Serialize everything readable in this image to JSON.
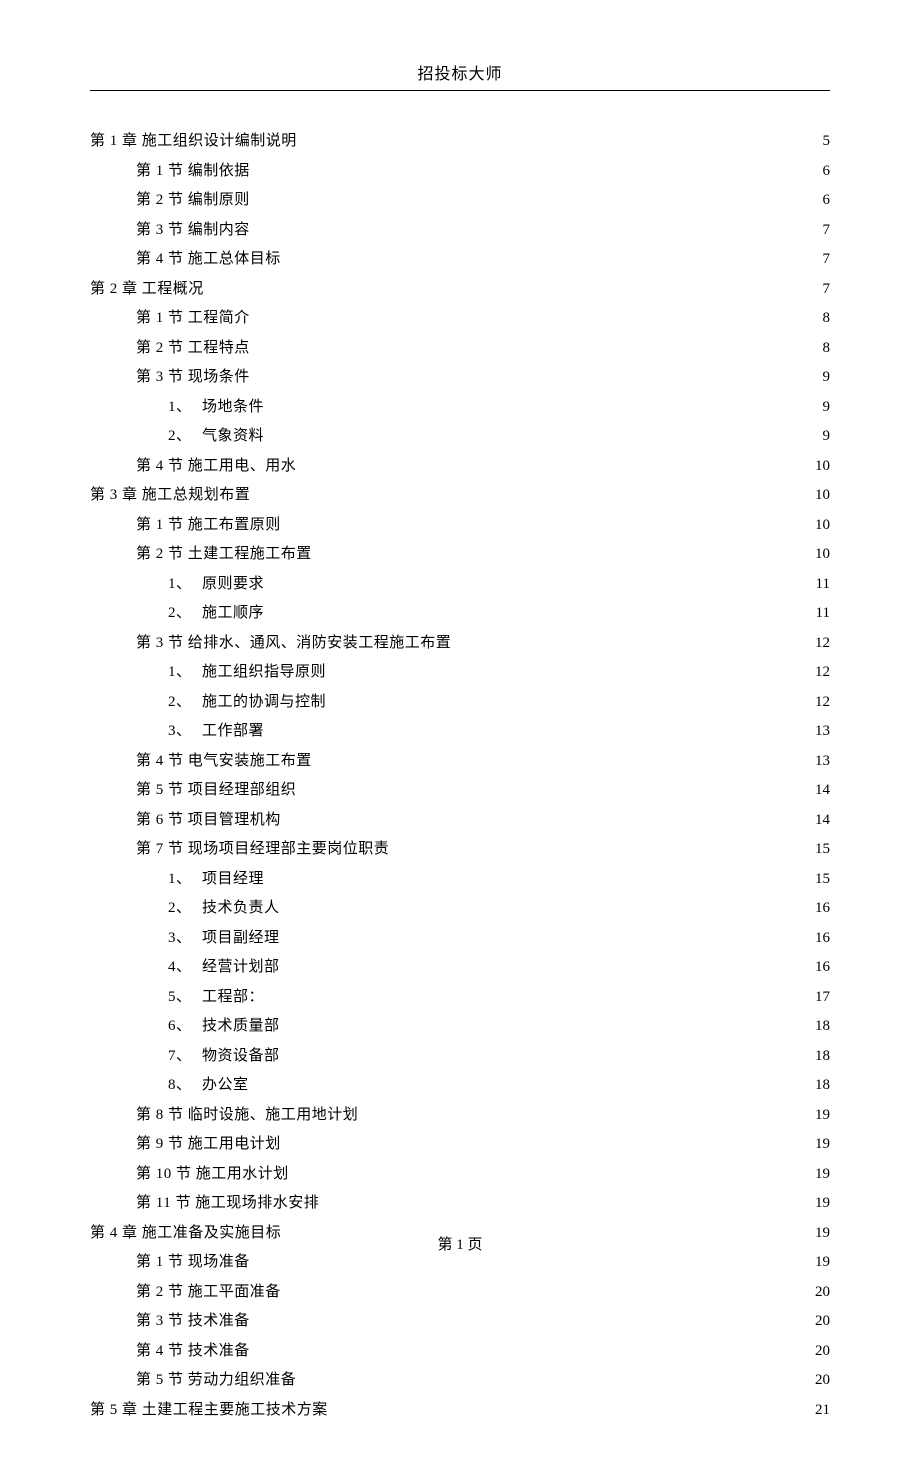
{
  "header": {
    "title": "招投标大师"
  },
  "footer": {
    "pageLabel": "第 1 页"
  },
  "toc": [
    {
      "indent": 0,
      "label": "第 1 章  施工组织设计编制说明",
      "page": "5"
    },
    {
      "indent": 1,
      "label": "第 1 节  编制依据",
      "page": "6"
    },
    {
      "indent": 1,
      "label": "第 2 节  编制原则",
      "page": "6"
    },
    {
      "indent": 1,
      "label": "第 3 节  编制内容",
      "page": "7"
    },
    {
      "indent": 1,
      "label": "第 4 节  施工总体目标",
      "page": "7"
    },
    {
      "indent": 0,
      "label": "第 2 章  工程概况",
      "page": "7"
    },
    {
      "indent": 1,
      "label": "第 1 节  工程简介",
      "page": "8"
    },
    {
      "indent": 1,
      "label": "第 2 节  工程特点",
      "page": "8"
    },
    {
      "indent": 1,
      "label": "第 3 节  现场条件",
      "page": "9"
    },
    {
      "indent": 2,
      "num": "1、",
      "title": "场地条件",
      "page": "9"
    },
    {
      "indent": 2,
      "num": "2、",
      "title": "气象资料",
      "page": "9"
    },
    {
      "indent": 1,
      "label": "第 4 节  施工用电、用水",
      "page": "10"
    },
    {
      "indent": 0,
      "label": "第 3 章  施工总规划布置",
      "page": "10"
    },
    {
      "indent": 1,
      "label": "第 1 节  施工布置原则",
      "page": "10"
    },
    {
      "indent": 1,
      "label": "第 2 节  土建工程施工布置",
      "page": "10"
    },
    {
      "indent": 2,
      "num": "1、",
      "title": "原则要求",
      "page": "11"
    },
    {
      "indent": 2,
      "num": "2、",
      "title": "施工顺序",
      "page": "11"
    },
    {
      "indent": 1,
      "label": "第 3 节  给排水、通风、消防安装工程施工布置",
      "page": "12"
    },
    {
      "indent": 2,
      "num": "1、",
      "title": "施工组织指导原则",
      "page": "12"
    },
    {
      "indent": 2,
      "num": "2、",
      "title": "施工的协调与控制",
      "page": "12"
    },
    {
      "indent": 2,
      "num": "3、",
      "title": "工作部署",
      "page": "13"
    },
    {
      "indent": 1,
      "label": "第 4 节  电气安装施工布置",
      "page": "13"
    },
    {
      "indent": 1,
      "label": "第 5 节  项目经理部组织",
      "page": "14"
    },
    {
      "indent": 1,
      "label": "第 6 节  项目管理机构",
      "page": "14"
    },
    {
      "indent": 1,
      "label": "第 7 节  现场项目经理部主要岗位职责",
      "page": "15"
    },
    {
      "indent": 2,
      "num": "1、",
      "title": "项目经理",
      "page": "15"
    },
    {
      "indent": 2,
      "num": "2、",
      "title": "技术负责人",
      "page": "16"
    },
    {
      "indent": 2,
      "num": "3、",
      "title": "项目副经理",
      "page": "16"
    },
    {
      "indent": 2,
      "num": "4、",
      "title": "经营计划部",
      "page": "16"
    },
    {
      "indent": 2,
      "num": "5、",
      "title": "工程部：",
      "page": "17"
    },
    {
      "indent": 2,
      "num": "6、",
      "title": "技术质量部",
      "page": "18"
    },
    {
      "indent": 2,
      "num": "7、",
      "title": "物资设备部",
      "page": "18"
    },
    {
      "indent": 2,
      "num": "8、",
      "title": "办公室",
      "page": "18"
    },
    {
      "indent": 1,
      "label": "第 8 节  临时设施、施工用地计划",
      "page": "19"
    },
    {
      "indent": 1,
      "label": "第 9 节  施工用电计划",
      "page": "19"
    },
    {
      "indent": 1,
      "label": "第 10 节  施工用水计划",
      "page": "19"
    },
    {
      "indent": 1,
      "label": "第 11 节  施工现场排水安排",
      "page": "19"
    },
    {
      "indent": 0,
      "label": "第 4 章  施工准备及实施目标",
      "page": "19"
    },
    {
      "indent": 1,
      "label": "第 1 节  现场准备",
      "page": "19"
    },
    {
      "indent": 1,
      "label": "第 2 节  施工平面准备",
      "page": "20"
    },
    {
      "indent": 1,
      "label": "第 3 节  技术准备",
      "page": "20"
    },
    {
      "indent": 1,
      "label": "第 4 节  技术准备",
      "page": "20"
    },
    {
      "indent": 1,
      "label": "第 5 节  劳动力组织准备",
      "page": "20"
    },
    {
      "indent": 0,
      "label": "第 5 章  土建工程主要施工技术方案",
      "page": "21"
    }
  ]
}
